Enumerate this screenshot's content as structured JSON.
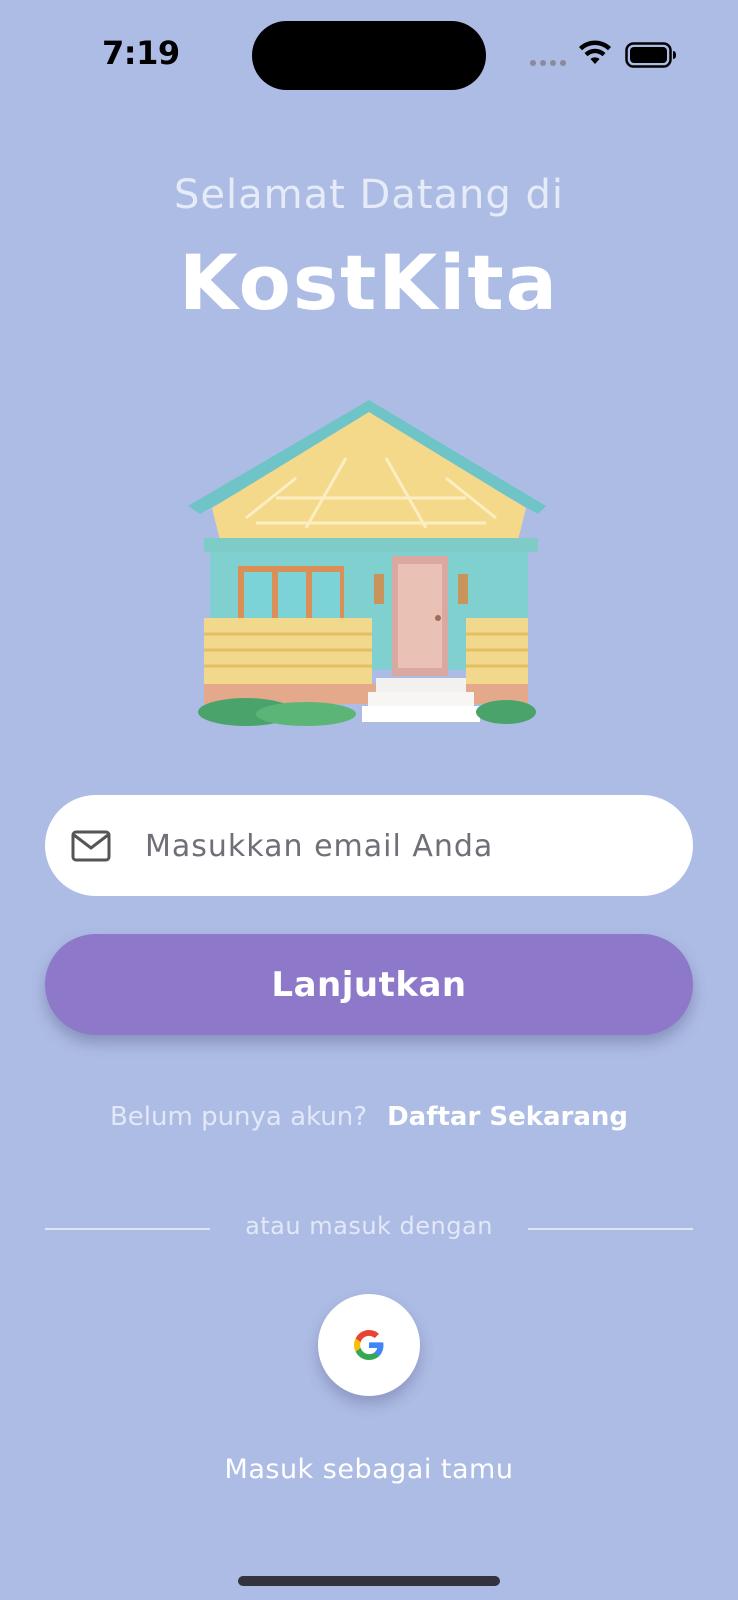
{
  "status_bar": {
    "time": "7:19"
  },
  "header": {
    "welcome": "Selamat Datang di",
    "brand": "KostKita"
  },
  "illustration": {
    "icon": "house-illustration"
  },
  "login_form": {
    "email_placeholder": "Masukkan email Anda",
    "email_value": "",
    "email_icon": "mail-icon",
    "continue_label": "Lanjutkan"
  },
  "register": {
    "prompt": "Belum punya akun?",
    "link": "Daftar Sekarang"
  },
  "alt_login": {
    "divider_text": "atau masuk dengan",
    "google_icon": "google-icon",
    "guest_label": "Masuk sebagai tamu"
  },
  "colors": {
    "background": "#adbce4",
    "primary_button": "#8e78c9",
    "text_white": "#ffffff"
  }
}
